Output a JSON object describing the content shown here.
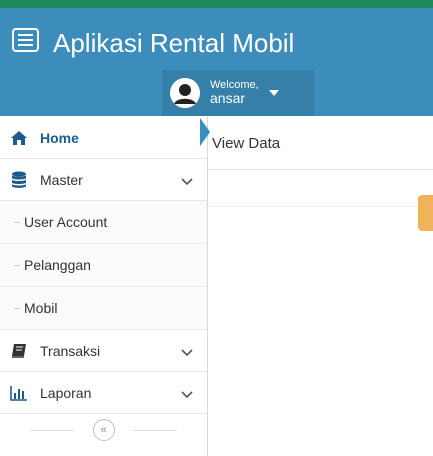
{
  "header": {
    "title": "Aplikasi Rental Mobil",
    "welcome_label": "Welcome,",
    "username": "ansar"
  },
  "sidebar": {
    "items": [
      {
        "label": "Home",
        "icon": "home-icon"
      },
      {
        "label": "Master",
        "icon": "database-icon"
      },
      {
        "label": "User Account"
      },
      {
        "label": "Pelanggan"
      },
      {
        "label": "Mobil"
      },
      {
        "label": "Transaksi",
        "icon": "book-icon"
      },
      {
        "label": "Laporan",
        "icon": "bar-chart-icon"
      }
    ],
    "collapse_glyph": "«"
  },
  "content": {
    "view_label": "View Data"
  },
  "colors": {
    "header_bg": "#3c8dbc",
    "top_strip": "#1e8a5e",
    "active_text": "#1d5b8f",
    "accent_tab": "#f0b25b"
  }
}
